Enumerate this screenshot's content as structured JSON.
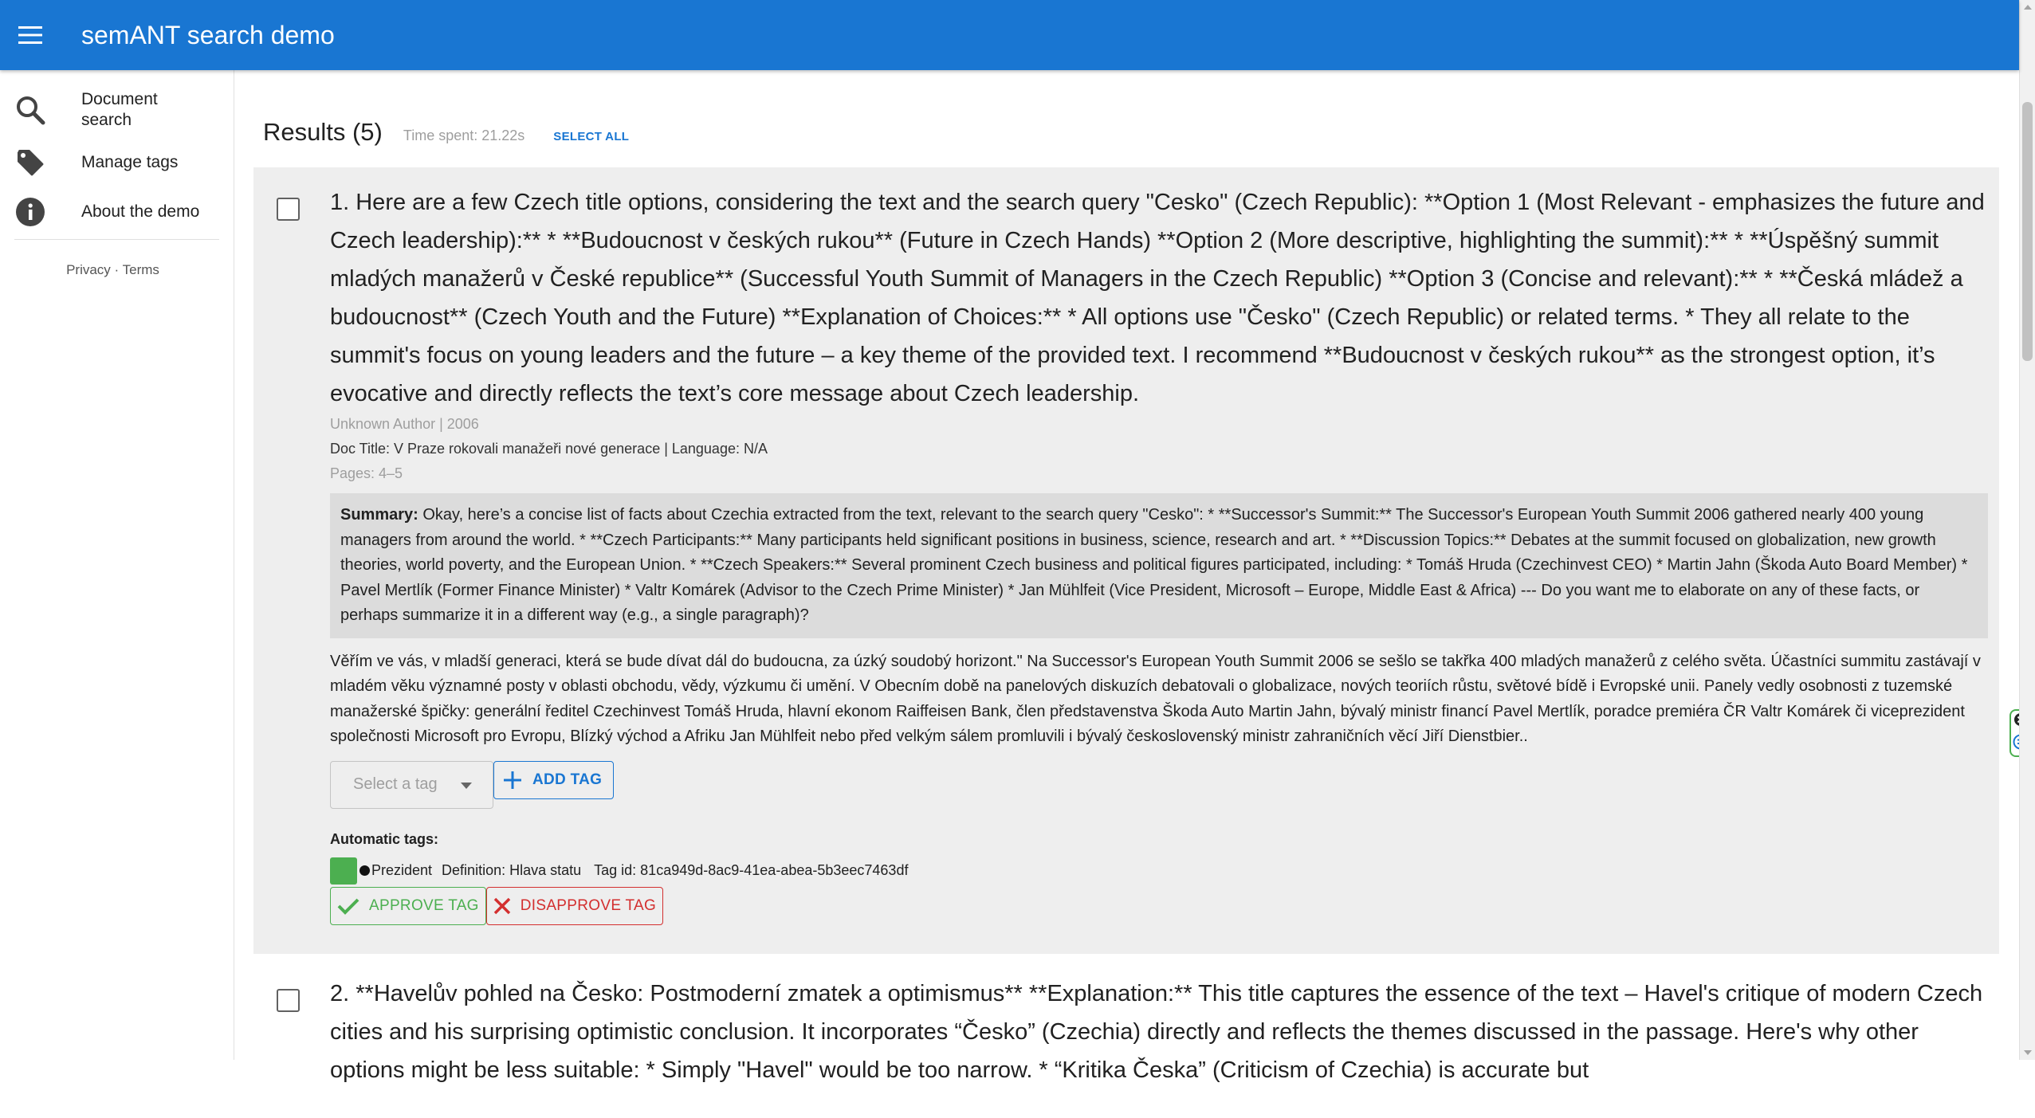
{
  "app": {
    "title": "semANT search demo"
  },
  "sidebar": {
    "items": [
      {
        "label": "Document search",
        "icon": "search-icon"
      },
      {
        "label": "Manage tags",
        "icon": "tag-icon"
      },
      {
        "label": "About the demo",
        "icon": "info-icon"
      }
    ],
    "privacy": "Privacy",
    "separator": " · ",
    "terms": "Terms"
  },
  "results": {
    "title": "Results (5)",
    "time_spent": "Time spent: 21.22s",
    "select_all": "SELECT ALL"
  },
  "result1": {
    "title": "1. Here are a few Czech title options, considering the text and the search query \"Cesko\" (Czech Republic): **Option 1 (Most Relevant - emphasizes the future and Czech leadership):** * **Budoucnost v českých rukou** (Future in Czech Hands) **Option 2 (More descriptive, highlighting the summit):** * **Úspěšný summit mladých manažerů v České republice** (Successful Youth Summit of Managers in the Czech Republic) **Option 3 (Concise and relevant):** * **Česká mládež a budoucnost** (Czech Youth and the Future) **Explanation of Choices:** * All options use \"Česko\" (Czech Republic) or related terms. * They all relate to the summit's focus on young leaders and the future – a key theme of the provided text. I recommend **Budoucnost v českých rukou** as the strongest option, it’s evocative and directly reflects the text’s core message about Czech leadership.",
    "author": "Unknown Author | 2006",
    "doc": "Doc Title: V Praze rokovali manažeři nové generace | Language: N/A",
    "pages": "Pages: 4–5",
    "summary_label": "Summary:",
    "summary": " Okay, here’s a concise list of facts about Czechia extracted from the text, relevant to the search query \"Cesko\": * **Successor's Summit:** The Successor's European Youth Summit 2006 gathered nearly 400 young managers from around the world. * **Czech Participants:** Many participants held significant positions in business, science, research and art. * **Discussion Topics:** Debates at the summit focused on globalization, new growth theories, world poverty, and the European Union. * **Czech Speakers:** Several prominent Czech business and political figures participated, including: * Tomáš Hruda (Czechinvest CEO) * Martin Jahn (Škoda Auto Board Member) * Pavel Mertlík (Former Finance Minister) * Valtr Komárek (Advisor to the Czech Prime Minister) * Jan Mühlfeit (Vice President, Microsoft – Europe, Middle East & Africa) --- Do you want me to elaborate on any of these facts, or perhaps summarize it in a different way (e.g., a single paragraph)?",
    "snippet": "Věřím ve vás, v mladší generaci, která se bude dívat dál do budoucna, za úzký soudobý horizont.\" Na Successor's European Youth Summit 2006 se sešlo se takřka 400 mladých manažerů z celého světa. Účastníci summitu zastávají v mladém věku významné posty v oblasti obchodu, vědy, výzkumu či umění. V Obecním době na panelových diskuzích debatovali o globalizace, nových teoriích růstu, světové bídě i Evropské unii. Panely vedly osobnosti z tuzemské manažerské špičky: generální ředitel Czechinvest Tomáš Hruda, hlavní ekonom Raiffeisen Bank, člen představenstva Škoda Auto Martin Jahn, bývalý ministr financí Pavel Mertlík, poradce premiéra ČR Valtr Komárek či viceprezident společnosti Microsoft pro Evropu, Blízký východ a Afriku Jan Mühlfeit nebo před velkým sálem promluvili i bývalý československý ministr zahraničních věcí Jiří Dienstbier..",
    "select_tag_placeholder": "Select a tag",
    "add_tag": "ADD TAG",
    "auto_tags_label": "Automatic tags:",
    "tag_name": "Prezident",
    "tag_definition": "Definition: Hlava statu",
    "tag_id": "Tag id: 81ca949d-8ac9-41ea-abea-5b3eec7463df",
    "tag_color": "#4caf50",
    "approve": "APPROVE TAG",
    "disapprove": "DISAPPROVE TAG"
  },
  "result2": {
    "title": "2. **Havelův pohled na Česko: Postmoderní zmatek a optimismus** **Explanation:** This title captures the essence of the text – Havel's critique of modern Czech cities and his surprising optimistic conclusion. It incorporates “Česko” (Czechia) directly and reflects the themes discussed in the passage. Here's why other options might be less suitable: * Simply \"Havel\" would be too narrow. * “Kritika Česka” (Criticism of Czechia) is accurate but"
  },
  "colors": {
    "primary": "#1976d2",
    "approve": "#4caf50",
    "disapprove": "#d32f2f"
  }
}
